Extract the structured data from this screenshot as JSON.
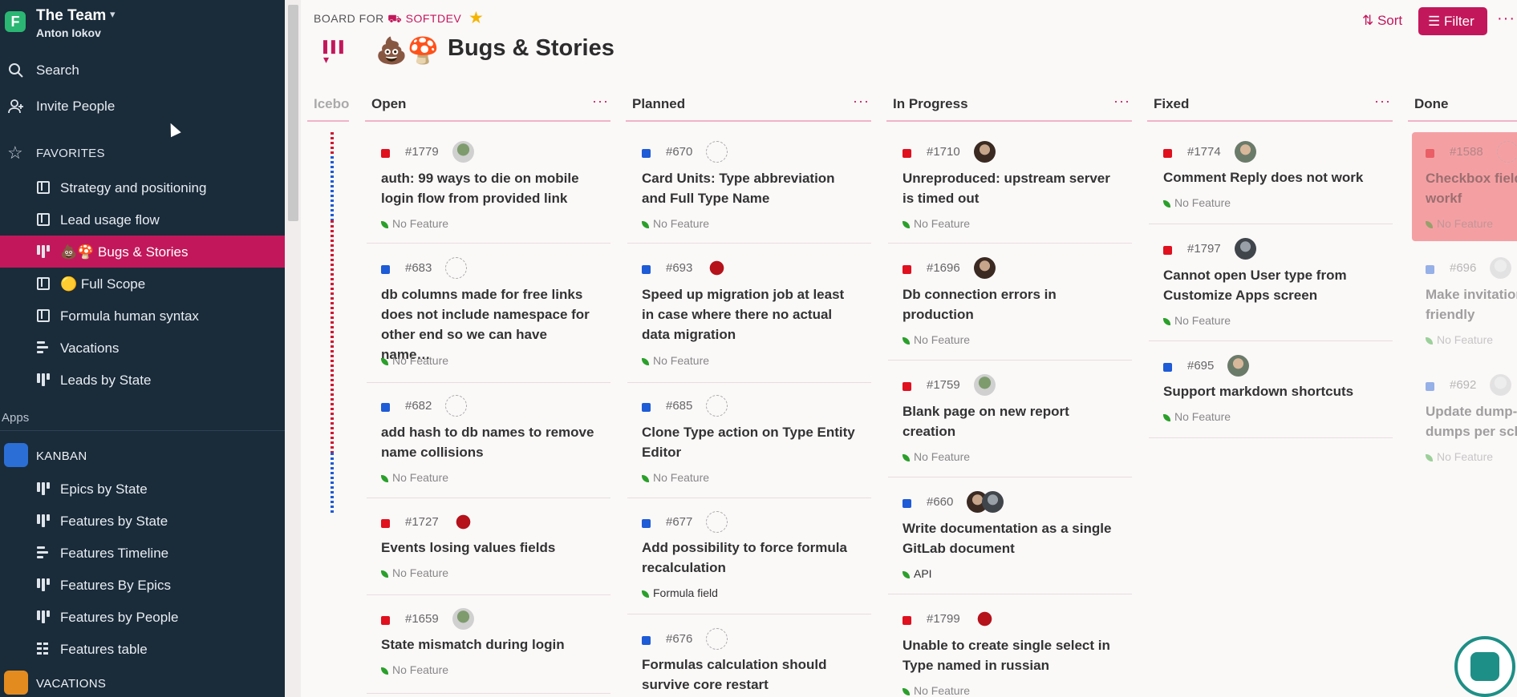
{
  "workspace": {
    "name": "The Team",
    "user": "Anton Iokov",
    "logo": "F"
  },
  "sidebar": {
    "search": "Search",
    "invite": "Invite People",
    "favorites_header": "FAVORITES",
    "favorites": [
      {
        "label": "Strategy and positioning",
        "icon": "book-icon"
      },
      {
        "label": "Lead usage flow",
        "icon": "book-icon"
      },
      {
        "label": "💩🍄 Bugs & Stories",
        "icon": "board-icon",
        "active": true
      },
      {
        "label": "🟡 Full Scope",
        "icon": "book-icon"
      },
      {
        "label": "Formula human syntax",
        "icon": "book-icon"
      },
      {
        "label": "Vacations",
        "icon": "timeline-icon"
      },
      {
        "label": "Leads by State",
        "icon": "board-icon"
      }
    ],
    "apps_label": "Apps",
    "apps": [
      {
        "name": "KANBAN",
        "color": "#2b6fd6"
      },
      {
        "name": "VACATIONS",
        "color": "#e38b1f"
      }
    ],
    "kanban_items": [
      {
        "label": "Epics by State",
        "icon": "board-icon"
      },
      {
        "label": "Features by State",
        "icon": "board-icon"
      },
      {
        "label": "Features Timeline",
        "icon": "timeline-icon"
      },
      {
        "label": "Features By Epics",
        "icon": "board-icon"
      },
      {
        "label": "Features by People",
        "icon": "board-icon"
      },
      {
        "label": "Features table",
        "icon": "table-icon"
      }
    ]
  },
  "header": {
    "board_for": "BOARD FOR",
    "project": "SOFTDEV",
    "title_emoji": "💩🍄",
    "title": "Bugs & Stories",
    "sort": "Sort",
    "filter": "Filter",
    "more": "···"
  },
  "colors": {
    "accent": "#c2185b",
    "bug": "#e0101e",
    "story": "#1e5bd6",
    "sidebar": "#1a2b3a"
  },
  "columns": [
    {
      "name": "Icebo"
    },
    {
      "name": "Open"
    },
    {
      "name": "Planned"
    },
    {
      "name": "In Progress"
    },
    {
      "name": "Fixed"
    },
    {
      "name": "Done"
    }
  ],
  "cards": {
    "open": [
      {
        "num": "#1779",
        "title": "auth: 99 ways to die on mobile login flow from provided link",
        "feature": "No Feature"
      },
      {
        "num": "#683",
        "title": "db columns made for free links does not include namespace for other end so we can have name…",
        "feature": "No Feature"
      },
      {
        "num": "#682",
        "title": "add hash to db names to remove name collisions",
        "feature": "No Feature"
      },
      {
        "num": "#1727",
        "title": "Events losing values fields",
        "feature": "No Feature"
      },
      {
        "num": "#1659",
        "title": "State mismatch during login",
        "feature": "No Feature"
      }
    ],
    "planned": [
      {
        "num": "#670",
        "title": "Card Units: Type abbreviation and Full Type Name",
        "feature": "No Feature"
      },
      {
        "num": "#693",
        "title": "Speed up migration job at least in case where there no actual data migration",
        "feature": "No Feature"
      },
      {
        "num": "#685",
        "title": "Clone Type action on Type Entity Editor",
        "feature": "No Feature"
      },
      {
        "num": "#677",
        "title": "Add possibility to force formula recalculation",
        "feature": "Formula field"
      },
      {
        "num": "#676",
        "title": "Formulas calculation should survive core restart",
        "feature": ""
      }
    ],
    "in_progress": [
      {
        "num": "#1710",
        "title": "Unreproduced: upstream server is timed out",
        "feature": "No Feature"
      },
      {
        "num": "#1696",
        "title": "Db connection errors in production",
        "feature": "No Feature"
      },
      {
        "num": "#1759",
        "title": "Blank page on new report creation",
        "feature": "No Feature"
      },
      {
        "num": "#660",
        "title": "Write documentation as a single GitLab document",
        "feature": "API"
      },
      {
        "num": "#1799",
        "title": "Unable to create single select in Type named in russian",
        "feature": "No Feature"
      }
    ],
    "fixed": [
      {
        "num": "#1774",
        "title": "Comment Reply does not work",
        "feature": "No Feature"
      },
      {
        "num": "#1797",
        "title": "Cannot open User type from Customize Apps screen",
        "feature": "No Feature"
      },
      {
        "num": "#695",
        "title": "Support markdown shortcuts",
        "feature": "No Feature"
      }
    ],
    "done": [
      {
        "num": "#1588",
        "title": "Checkbox field workf",
        "feature": "No Feature"
      },
      {
        "num": "#696",
        "title": "Make invitation friendly",
        "feature": "No Feature"
      },
      {
        "num": "#692",
        "title": "Update dump-dumps per sch",
        "feature": "No Feature"
      }
    ]
  }
}
